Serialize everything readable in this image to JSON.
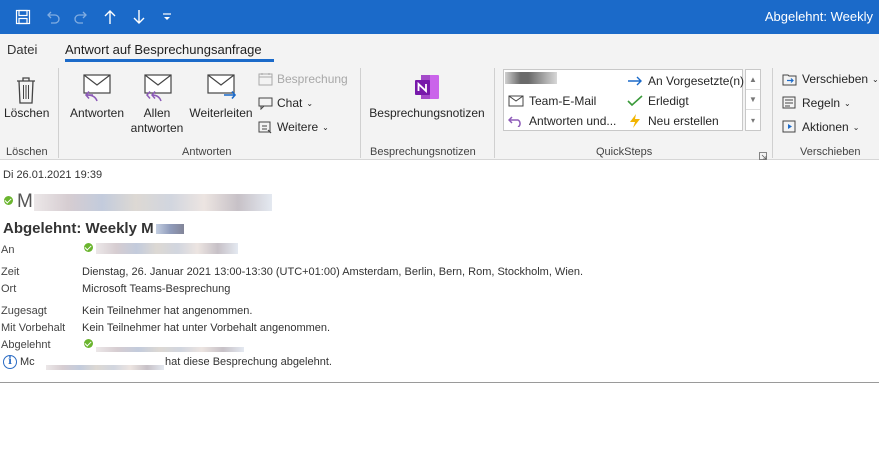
{
  "window": {
    "title": "Abgelehnt: Weekly"
  },
  "qat": {
    "save_icon": "save-icon",
    "undo_icon": "undo-icon",
    "redo_icon": "redo-icon",
    "up_icon": "arrow-up-icon",
    "down_icon": "arrow-down-icon",
    "customize_icon": "customize-qat-icon"
  },
  "tabs": [
    {
      "label": "Datei"
    },
    {
      "label": "Antwort auf Besprechungsanfrage"
    }
  ],
  "ribbon": {
    "loeschen": {
      "button": "Löschen",
      "group": "Löschen"
    },
    "antworten": {
      "reply": "Antworten",
      "reply_all_1": "Allen",
      "reply_all_2": "antworten",
      "forward": "Weiterleiten",
      "meeting": "Besprechung",
      "chat": "Chat",
      "more": "Weitere",
      "group": "Antworten"
    },
    "notes": {
      "button": "Besprechungsnotizen",
      "group": "Besprechungsnotizen"
    },
    "quicksteps": {
      "items": [
        "Team-E-Mail",
        "Antworten und...",
        "An Vorgesetzte(n)",
        "Erledigt",
        "Neu erstellen"
      ],
      "group": "QuickSteps"
    },
    "verschieben": {
      "move": "Verschieben",
      "rules": "Regeln",
      "actions": "Aktionen",
      "group": "Verschieben"
    }
  },
  "message": {
    "date": "Di 26.01.2021 19:39",
    "sender_initial": "M",
    "subject": "Abgelehnt: Weekly M",
    "fields": {
      "an_label": "An",
      "zeit_label": "Zeit",
      "zeit_value": "Dienstag, 26. Januar 2021 13:00-13:30 (UTC+01:00) Amsterdam, Berlin, Bern, Rom, Stockholm, Wien.",
      "ort_label": "Ort",
      "ort_value": "Microsoft Teams-Besprechung",
      "zugesagt_label": "Zugesagt",
      "zugesagt_value": "Kein Teilnehmer hat angenommen.",
      "vorbehalt_label": "Mit Vorbehalt",
      "vorbehalt_value": "Kein Teilnehmer hat unter Vorbehalt angenommen.",
      "abgelehnt_label": "Abgelehnt"
    },
    "info_prefix": "Mc",
    "info_text": "hat diese Besprechung abgelehnt."
  }
}
